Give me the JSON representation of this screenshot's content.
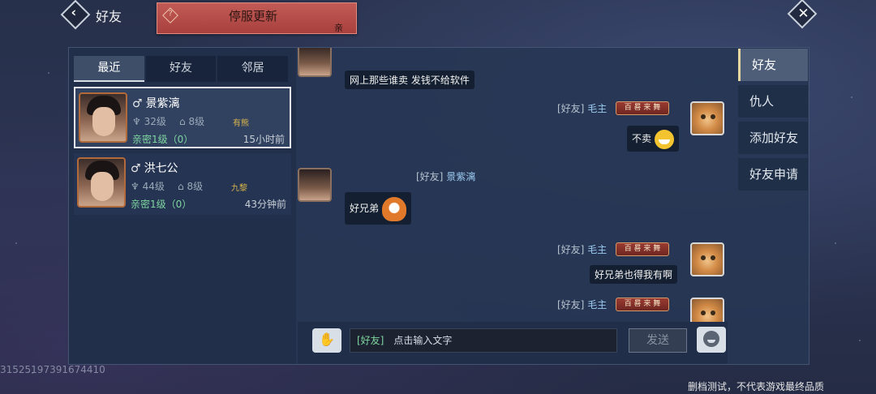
{
  "topbar": {
    "title": "好友",
    "notice_title": "停服更新",
    "notice_sub": "亲"
  },
  "left": {
    "tabs": [
      {
        "label": "最近",
        "active": true
      },
      {
        "label": "好友",
        "active": false
      },
      {
        "label": "邻居",
        "active": false
      }
    ],
    "friends": [
      {
        "sex": "♂",
        "name": "景紫漓",
        "level": "32级",
        "home_level": "8级",
        "tag": "有熊",
        "intimacy": "亲密1级（0）",
        "last_seen": "15小时前"
      },
      {
        "sex": "♂",
        "name": "洪七公",
        "level": "44级",
        "home_level": "8级",
        "tag": "九黎",
        "intimacy": "亲密1级（0）",
        "last_seen": "43分钟前"
      }
    ]
  },
  "chat": {
    "messages": [
      {
        "text": "网上那些谁卖 发钱不给软件"
      },
      {
        "relation": "[好友]",
        "name": "毛主",
        "badge": "百 晷 来 舞",
        "text": "不卖"
      },
      {
        "relation": "[好友]",
        "name": "景紫漓",
        "text": "好兄弟"
      },
      {
        "relation": "[好友]",
        "name": "毛主",
        "badge": "百 晷 来 舞",
        "text": "好兄弟也得我有啊"
      },
      {
        "relation": "[好友]",
        "name": "毛主",
        "badge": "百 晷 来 舞"
      }
    ]
  },
  "input": {
    "channel": "[好友]",
    "placeholder": "点击输入文字",
    "send_label": "发送"
  },
  "right_nav": {
    "items": [
      {
        "label": "好友",
        "active": true
      },
      {
        "label": "仇人",
        "active": false
      },
      {
        "label": "添加好友",
        "active": false
      },
      {
        "label": "好友申请",
        "active": false
      }
    ]
  },
  "uid": "31525197391674410",
  "footer_note": "删档测试，不代表游戏最终品质"
}
